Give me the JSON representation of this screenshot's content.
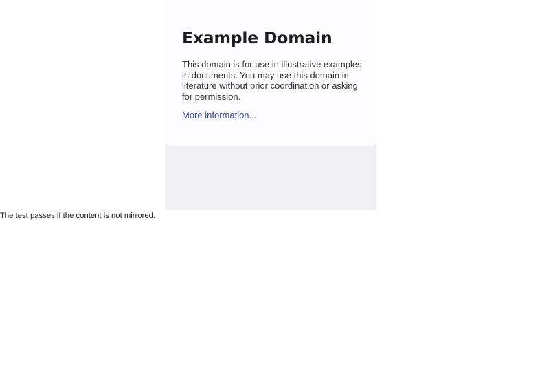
{
  "embedded_page": {
    "title": "Example Domain",
    "body": "This domain is for use in illustrative examples in documents. You may use this domain in literature without prior coordination or asking for permission.",
    "link_text": "More information..."
  },
  "test_note": "The test passes if the content is not mirrored.",
  "colors": {
    "card_background": "#fdfdff",
    "frame_background": "#f0f0f2",
    "link": "#38488f",
    "heading": "#1d1d1f"
  }
}
